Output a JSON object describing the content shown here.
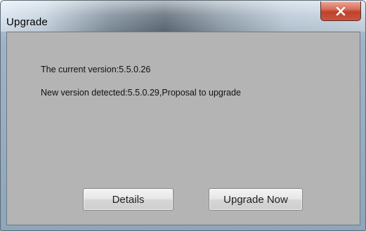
{
  "window": {
    "title": "Upgrade",
    "close_icon": "close-x-icon"
  },
  "message": {
    "current_version": "The current version:5.5.0.26",
    "new_version": "New version detected:5.5.0.29,Proposal to upgrade"
  },
  "buttons": {
    "details_label": "Details",
    "upgrade_label": "Upgrade Now"
  },
  "colors": {
    "client_background": "#b4b4b4",
    "close_button": "#c8462f"
  }
}
